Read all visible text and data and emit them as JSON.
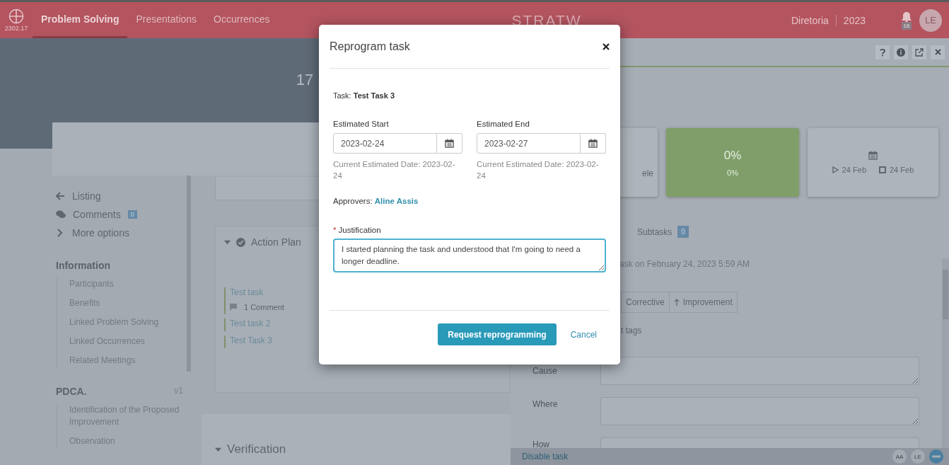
{
  "topbar": {
    "version": "2302.17",
    "tabs": [
      {
        "label": "Problem Solving",
        "selected": true
      },
      {
        "label": "Presentations",
        "selected": false
      },
      {
        "label": "Occurrences",
        "selected": false
      }
    ],
    "logo": "STRATW",
    "unit": "Diretoria",
    "year": "2023",
    "notifications": "16",
    "avatar": "LE"
  },
  "header": {
    "title": "17"
  },
  "sidebar": {
    "nav": [
      {
        "kind": "back",
        "label": "Listing"
      },
      {
        "kind": "comments",
        "label": "Comments",
        "badge": "0"
      },
      {
        "kind": "more",
        "label": "More options"
      }
    ],
    "sections": [
      {
        "title": "Information",
        "items": [
          "Participants",
          "Benefits",
          "Linked Problem Solving",
          "Linked Occurrences",
          "Related Meetings"
        ]
      },
      {
        "title": "PDCA.",
        "version": "v1",
        "items": [
          "Identification of the Proposed Improvement",
          "Observation"
        ]
      }
    ]
  },
  "action_plan": {
    "title": "Action Plan",
    "expanded": true,
    "tasks": [
      {
        "name": "Test task",
        "comments": "1 Comment"
      },
      {
        "name": "Test task 2"
      },
      {
        "name": "Test Task 3"
      }
    ]
  },
  "verification": {
    "title": "Verification",
    "expanded": true
  },
  "task_panel": {
    "cards": [
      {
        "kind": "text",
        "text": "ele"
      },
      {
        "kind": "progress",
        "value": "0%",
        "caption": "0%"
      },
      {
        "kind": "dates",
        "start": "24 Feb",
        "end": "24 Feb"
      }
    ],
    "tabs": [
      {
        "label": "Subtasks",
        "badge": "0"
      }
    ],
    "log": "ask on February 24, 2023 5:59 AM",
    "types": [
      {
        "kind": "plain",
        "label": "Corrective"
      },
      {
        "kind": "arrow",
        "label": "Improvement"
      }
    ],
    "tags": "t tags",
    "fields": [
      {
        "kind": "textarea",
        "label": "Cause"
      },
      {
        "kind": "textarea",
        "label": "Where"
      },
      {
        "kind": "textarea",
        "label": "How"
      }
    ],
    "footer": {
      "action": "Disable task",
      "avatars": [
        "AA",
        "LE"
      ]
    }
  },
  "dialog": {
    "title": "Reprogram task",
    "task": "Task: **Test Task 3**",
    "dates": [
      {
        "label": "Estimated Start",
        "value": "2023-02-24",
        "current": "Current Estimated Date: 2023-02-24"
      },
      {
        "label": "Estimated End",
        "value": "2023-02-27",
        "current": "Current Estimated Date: 2023-02-24"
      }
    ],
    "approvers_label": "Approvers:",
    "approver": "Aline Assis",
    "justification": {
      "label": "Justification",
      "required": true,
      "required_mark": "*",
      "value": "I started planning the task and understood that I'm going to need a longer deadline."
    },
    "primary": "Request reprogramming",
    "secondary": "Cancel"
  }
}
